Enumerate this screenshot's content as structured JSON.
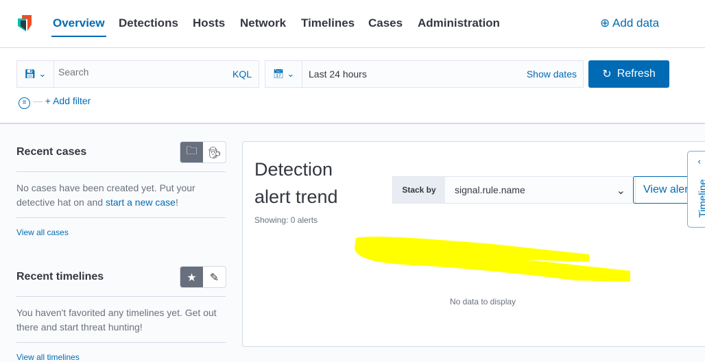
{
  "nav": {
    "tabs": [
      "Overview",
      "Detections",
      "Hosts",
      "Network",
      "Timelines",
      "Cases",
      "Administration"
    ],
    "active": "Overview",
    "add_data": "Add data"
  },
  "query": {
    "search_placeholder": "Search",
    "language": "KQL",
    "date_range": "Last 24 hours",
    "show_dates": "Show dates",
    "refresh": "Refresh",
    "add_filter": "+ Add filter"
  },
  "recent_cases": {
    "title": "Recent cases",
    "text": "No cases have been created yet. Put your detective hat on and ",
    "link": "start a new case",
    "suffix": "!",
    "view_all": "View all cases"
  },
  "recent_timelines": {
    "title": "Recent timelines",
    "text": "You haven't favorited any timelines yet. Get out there and start threat hunting!",
    "view_all": "View all timelines"
  },
  "alerts": {
    "title_line1": "Detection",
    "title_line2": "alert trend",
    "stack_by_label": "Stack by",
    "stack_by_value": "signal.rule.name",
    "showing": "Showing: 0 alerts",
    "view_alerts": "View alerts",
    "no_data": "No data to display"
  },
  "timeline_flyout": {
    "label": "Timeline"
  },
  "colors": {
    "accent": "#006bb4",
    "redaction": "#ffff00"
  }
}
